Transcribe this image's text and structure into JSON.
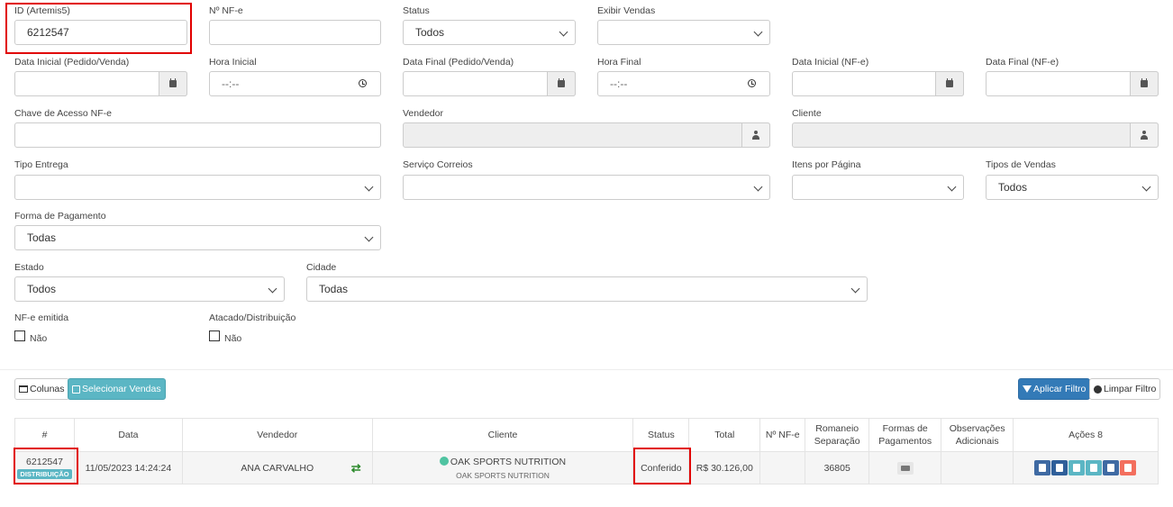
{
  "filters": {
    "id_artemis": {
      "label": "ID (Artemis5)",
      "value": "6212547"
    },
    "nf_number": {
      "label": "Nº NF-e",
      "value": ""
    },
    "status": {
      "label": "Status",
      "value": "Todos"
    },
    "show_sales": {
      "label": "Exibir Vendas",
      "value": ""
    },
    "start_date": {
      "label": "Data Inicial (Pedido/Venda)",
      "value": ""
    },
    "start_time": {
      "label": "Hora Inicial",
      "value": "--:--"
    },
    "end_date": {
      "label": "Data Final (Pedido/Venda)",
      "value": ""
    },
    "end_time": {
      "label": "Hora Final",
      "value": "--:--"
    },
    "nfe_start_date": {
      "label": "Data Inicial (NF-e)",
      "value": ""
    },
    "nfe_end_date": {
      "label": "Data Final (NF-e)",
      "value": ""
    },
    "access_key": {
      "label": "Chave de Acesso NF-e",
      "value": ""
    },
    "seller": {
      "label": "Vendedor",
      "value": ""
    },
    "customer": {
      "label": "Cliente",
      "value": ""
    },
    "delivery_type": {
      "label": "Tipo Entrega",
      "value": ""
    },
    "post_service": {
      "label": "Serviço Correios",
      "value": ""
    },
    "items_per_page": {
      "label": "Itens por Página",
      "value": ""
    },
    "sale_types": {
      "label": "Tipos de Vendas",
      "value": "Todos"
    },
    "payment_method": {
      "label": "Forma de Pagamento",
      "value": "Todas"
    },
    "state": {
      "label": "Estado",
      "value": "Todos"
    },
    "city": {
      "label": "Cidade",
      "value": "Todas"
    },
    "nfe_issued": {
      "label": "NF-e emitida",
      "option": "Não"
    },
    "wholesale": {
      "label": "Atacado/Distribuição",
      "option": "Não"
    }
  },
  "toolbar": {
    "columns": "Colunas",
    "select_sales": "Selecionar Vendas",
    "apply_filter": "Aplicar Filtro",
    "clear_filter": "Limpar Filtro"
  },
  "table": {
    "headers": {
      "num": "#",
      "date": "Data",
      "seller": "Vendedor",
      "customer": "Cliente",
      "status": "Status",
      "total": "Total",
      "nf": "Nº NF-e",
      "romaneio1": "Romaneio",
      "romaneio2": "Separação",
      "payments1": "Formas de",
      "payments2": "Pagamentos",
      "notes1": "Observações",
      "notes2": "Adicionais",
      "actions": "Ações 8"
    },
    "row": {
      "id": "6212547",
      "badge": "DISTRIBUIÇÃO",
      "date": "11/05/2023 14:24:24",
      "seller": "ANA CARVALHO",
      "customer": "OAK SPORTS NUTRITION",
      "customer_sub": "OAK SPORTS NUTRITION",
      "status": "Conferido",
      "total": "R$ 30.126,00",
      "nf": "",
      "romaneio": "36805",
      "notes": ""
    }
  },
  "colors": {
    "highlight": "#e10000",
    "primary": "#337ab7",
    "info": "#5bb6c4",
    "danger": "#f36f5e"
  }
}
